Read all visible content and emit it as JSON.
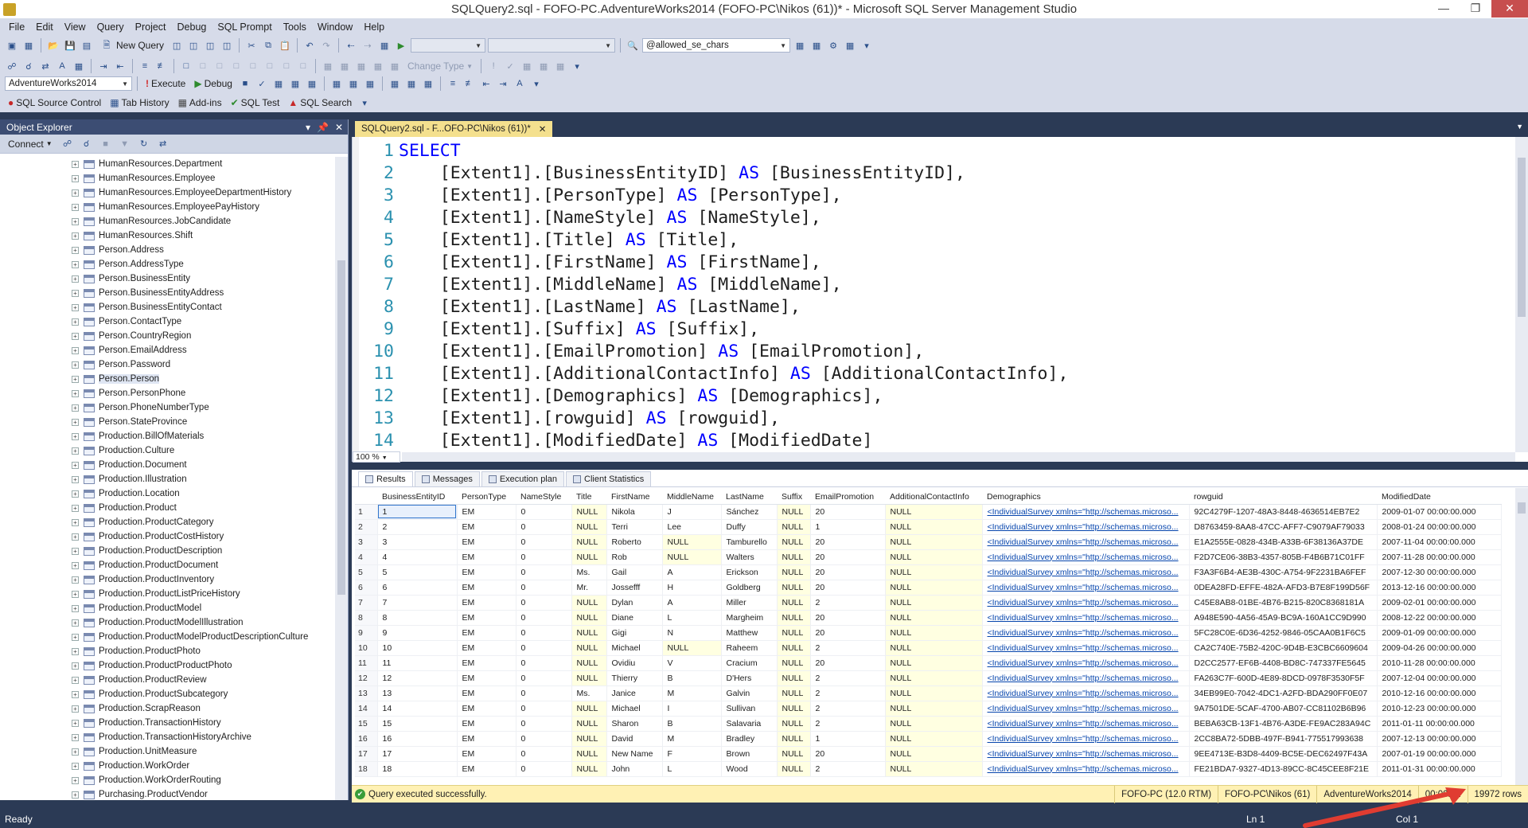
{
  "window": {
    "title": "SQLQuery2.sql - FOFO-PC.AdventureWorks2014 (FOFO-PC\\Nikos (61))* - Microsoft SQL Server Management Studio"
  },
  "menu": [
    "File",
    "Edit",
    "View",
    "Query",
    "Project",
    "Debug",
    "SQL Prompt",
    "Tools",
    "Window",
    "Help"
  ],
  "toolbar1": {
    "new_query": "New Query",
    "search_combo_value": "@allowed_se_chars"
  },
  "toolbar2": {
    "database": "AdventureWorks2014",
    "execute": "Execute",
    "debug": "Debug",
    "change_type": "Change Type"
  },
  "toolbar3": {
    "source_control": "SQL Source Control",
    "tab_history": "Tab History",
    "addins": "Add-ins",
    "sql_test": "SQL Test",
    "sql_search": "SQL Search"
  },
  "object_explorer": {
    "title": "Object Explorer",
    "connect": "Connect",
    "items": [
      "HumanResources.Department",
      "HumanResources.Employee",
      "HumanResources.EmployeeDepartmentHistory",
      "HumanResources.EmployeePayHistory",
      "HumanResources.JobCandidate",
      "HumanResources.Shift",
      "Person.Address",
      "Person.AddressType",
      "Person.BusinessEntity",
      "Person.BusinessEntityAddress",
      "Person.BusinessEntityContact",
      "Person.ContactType",
      "Person.CountryRegion",
      "Person.EmailAddress",
      "Person.Password",
      "Person.Person",
      "Person.PersonPhone",
      "Person.PhoneNumberType",
      "Person.StateProvince",
      "Production.BillOfMaterials",
      "Production.Culture",
      "Production.Document",
      "Production.Illustration",
      "Production.Location",
      "Production.Product",
      "Production.ProductCategory",
      "Production.ProductCostHistory",
      "Production.ProductDescription",
      "Production.ProductDocument",
      "Production.ProductInventory",
      "Production.ProductListPriceHistory",
      "Production.ProductModel",
      "Production.ProductModelIllustration",
      "Production.ProductModelProductDescriptionCulture",
      "Production.ProductPhoto",
      "Production.ProductProductPhoto",
      "Production.ProductReview",
      "Production.ProductSubcategory",
      "Production.ScrapReason",
      "Production.TransactionHistory",
      "Production.TransactionHistoryArchive",
      "Production.UnitMeasure",
      "Production.WorkOrder",
      "Production.WorkOrderRouting",
      "Purchasing.ProductVendor"
    ]
  },
  "editor": {
    "tab_label": "SQLQuery2.sql - F...OFO-PC\\Nikos (61))*",
    "zoom": "100 %",
    "lines": [
      {
        "n": "1",
        "pre": "",
        "kw": "SELECT",
        "post": ""
      },
      {
        "n": "2",
        "pre": "    [Extent1].[BusinessEntityID] ",
        "kw": "AS",
        "post": " [BusinessEntityID],"
      },
      {
        "n": "3",
        "pre": "    [Extent1].[PersonType] ",
        "kw": "AS",
        "post": " [PersonType],"
      },
      {
        "n": "4",
        "pre": "    [Extent1].[NameStyle] ",
        "kw": "AS",
        "post": " [NameStyle],"
      },
      {
        "n": "5",
        "pre": "    [Extent1].[Title] ",
        "kw": "AS",
        "post": " [Title],"
      },
      {
        "n": "6",
        "pre": "    [Extent1].[FirstName] ",
        "kw": "AS",
        "post": " [FirstName],"
      },
      {
        "n": "7",
        "pre": "    [Extent1].[MiddleName] ",
        "kw": "AS",
        "post": " [MiddleName],"
      },
      {
        "n": "8",
        "pre": "    [Extent1].[LastName] ",
        "kw": "AS",
        "post": " [LastName],"
      },
      {
        "n": "9",
        "pre": "    [Extent1].[Suffix] ",
        "kw": "AS",
        "post": " [Suffix],"
      },
      {
        "n": "10",
        "pre": "    [Extent1].[EmailPromotion] ",
        "kw": "AS",
        "post": " [EmailPromotion],"
      },
      {
        "n": "11",
        "pre": "    [Extent1].[AdditionalContactInfo] ",
        "kw": "AS",
        "post": " [AdditionalContactInfo],"
      },
      {
        "n": "12",
        "pre": "    [Extent1].[Demographics] ",
        "kw": "AS",
        "post": " [Demographics],"
      },
      {
        "n": "13",
        "pre": "    [Extent1].[rowguid] ",
        "kw": "AS",
        "post": " [rowguid],"
      },
      {
        "n": "14",
        "pre": "    [Extent1].[ModifiedDate] ",
        "kw": "AS",
        "post": " [ModifiedDate]"
      }
    ]
  },
  "results": {
    "tabs": [
      "Results",
      "Messages",
      "Execution plan",
      "Client Statistics"
    ],
    "columns": [
      "",
      "BusinessEntityID",
      "PersonType",
      "NameStyle",
      "Title",
      "FirstName",
      "MiddleName",
      "LastName",
      "Suffix",
      "EmailPromotion",
      "AdditionalContactInfo",
      "Demographics",
      "rowguid",
      "ModifiedDate"
    ],
    "rows": [
      [
        "1",
        "1",
        "EM",
        "0",
        "NULL",
        "Nikola",
        "J",
        "Sánchez",
        "NULL",
        "20",
        "NULL",
        "<IndividualSurvey xmlns=\"http://schemas.microso...",
        "92C4279F-1207-48A3-8448-4636514EB7E2",
        "2009-01-07 00:00:00.000"
      ],
      [
        "2",
        "2",
        "EM",
        "0",
        "NULL",
        "Terri",
        "Lee",
        "Duffy",
        "NULL",
        "1",
        "NULL",
        "<IndividualSurvey xmlns=\"http://schemas.microso...",
        "D8763459-8AA8-47CC-AFF7-C9079AF79033",
        "2008-01-24 00:00:00.000"
      ],
      [
        "3",
        "3",
        "EM",
        "0",
        "NULL",
        "Roberto",
        "NULL",
        "Tamburello",
        "NULL",
        "20",
        "NULL",
        "<IndividualSurvey xmlns=\"http://schemas.microso...",
        "E1A2555E-0828-434B-A33B-6F38136A37DE",
        "2007-11-04 00:00:00.000"
      ],
      [
        "4",
        "4",
        "EM",
        "0",
        "NULL",
        "Rob",
        "NULL",
        "Walters",
        "NULL",
        "20",
        "NULL",
        "<IndividualSurvey xmlns=\"http://schemas.microso...",
        "F2D7CE06-38B3-4357-805B-F4B6B71C01FF",
        "2007-11-28 00:00:00.000"
      ],
      [
        "5",
        "5",
        "EM",
        "0",
        "Ms.",
        "Gail",
        "A",
        "Erickson",
        "NULL",
        "20",
        "NULL",
        "<IndividualSurvey xmlns=\"http://schemas.microso...",
        "F3A3F6B4-AE3B-430C-A754-9F2231BA6FEF",
        "2007-12-30 00:00:00.000"
      ],
      [
        "6",
        "6",
        "EM",
        "0",
        "Mr.",
        "Jossefff",
        "H",
        "Goldberg",
        "NULL",
        "20",
        "NULL",
        "<IndividualSurvey xmlns=\"http://schemas.microso...",
        "0DEA28FD-EFFE-482A-AFD3-B7E8F199D56F",
        "2013-12-16 00:00:00.000"
      ],
      [
        "7",
        "7",
        "EM",
        "0",
        "NULL",
        "Dylan",
        "A",
        "Miller",
        "NULL",
        "2",
        "NULL",
        "<IndividualSurvey xmlns=\"http://schemas.microso...",
        "C45E8AB8-01BE-4B76-B215-820C8368181A",
        "2009-02-01 00:00:00.000"
      ],
      [
        "8",
        "8",
        "EM",
        "0",
        "NULL",
        "Diane",
        "L",
        "Margheim",
        "NULL",
        "20",
        "NULL",
        "<IndividualSurvey xmlns=\"http://schemas.microso...",
        "A948E590-4A56-45A9-BC9A-160A1CC9D990",
        "2008-12-22 00:00:00.000"
      ],
      [
        "9",
        "9",
        "EM",
        "0",
        "NULL",
        "Gigi",
        "N",
        "Matthew",
        "NULL",
        "20",
        "NULL",
        "<IndividualSurvey xmlns=\"http://schemas.microso...",
        "5FC28C0E-6D36-4252-9846-05CAA0B1F6C5",
        "2009-01-09 00:00:00.000"
      ],
      [
        "10",
        "10",
        "EM",
        "0",
        "NULL",
        "Michael",
        "NULL",
        "Raheem",
        "NULL",
        "2",
        "NULL",
        "<IndividualSurvey xmlns=\"http://schemas.microso...",
        "CA2C740E-75B2-420C-9D4B-E3CBC6609604",
        "2009-04-26 00:00:00.000"
      ],
      [
        "11",
        "11",
        "EM",
        "0",
        "NULL",
        "Ovidiu",
        "V",
        "Cracium",
        "NULL",
        "20",
        "NULL",
        "<IndividualSurvey xmlns=\"http://schemas.microso...",
        "D2CC2577-EF6B-4408-BD8C-747337FE5645",
        "2010-11-28 00:00:00.000"
      ],
      [
        "12",
        "12",
        "EM",
        "0",
        "NULL",
        "Thierry",
        "B",
        "D'Hers",
        "NULL",
        "2",
        "NULL",
        "<IndividualSurvey xmlns=\"http://schemas.microso...",
        "FA263C7F-600D-4E89-8DCD-0978F3530F5F",
        "2007-12-04 00:00:00.000"
      ],
      [
        "13",
        "13",
        "EM",
        "0",
        "Ms.",
        "Janice",
        "M",
        "Galvin",
        "NULL",
        "2",
        "NULL",
        "<IndividualSurvey xmlns=\"http://schemas.microso...",
        "34EB99E0-7042-4DC1-A2FD-BDA290FF0E07",
        "2010-12-16 00:00:00.000"
      ],
      [
        "14",
        "14",
        "EM",
        "0",
        "NULL",
        "Michael",
        "I",
        "Sullivan",
        "NULL",
        "2",
        "NULL",
        "<IndividualSurvey xmlns=\"http://schemas.microso...",
        "9A7501DE-5CAF-4700-AB07-CC81102B6B96",
        "2010-12-23 00:00:00.000"
      ],
      [
        "15",
        "15",
        "EM",
        "0",
        "NULL",
        "Sharon",
        "B",
        "Salavaria",
        "NULL",
        "2",
        "NULL",
        "<IndividualSurvey xmlns=\"http://schemas.microso...",
        "BEBA63CB-13F1-4B76-A3DE-FE9AC283A94C",
        "2011-01-11 00:00:00.000"
      ],
      [
        "16",
        "16",
        "EM",
        "0",
        "NULL",
        "David",
        "M",
        "Bradley",
        "NULL",
        "1",
        "NULL",
        "<IndividualSurvey xmlns=\"http://schemas.microso...",
        "2CC8BA72-5DBB-497F-B941-775517993638",
        "2007-12-13 00:00:00.000"
      ],
      [
        "17",
        "17",
        "EM",
        "0",
        "NULL",
        "New Name",
        "F",
        "Brown",
        "NULL",
        "20",
        "NULL",
        "<IndividualSurvey xmlns=\"http://schemas.microso...",
        "9EE4713E-B3D8-4409-BC5E-DEC62497F43A",
        "2007-01-19 00:00:00.000"
      ],
      [
        "18",
        "18",
        "EM",
        "0",
        "NULL",
        "John",
        "L",
        "Wood",
        "NULL",
        "2",
        "NULL",
        "<IndividualSurvey xmlns=\"http://schemas.microso...",
        "FE21BDA7-9327-4D13-89CC-8C45CEE8F21E",
        "2011-01-31 00:00:00.000"
      ]
    ]
  },
  "query_status": {
    "message": "Query executed successfully.",
    "server": "FOFO-PC (12.0 RTM)",
    "user": "FOFO-PC\\Nikos (61)",
    "database": "AdventureWorks2014",
    "elapsed": "00:00:01",
    "rows": "19972 rows"
  },
  "statusbar": {
    "ready": "Ready",
    "ln": "Ln 1",
    "col": "Col 1"
  },
  "colors": {
    "accent_dark": "#2b3a55",
    "toolbar": "#d6dbe9",
    "tab_active": "#f4e08e",
    "status_ok": "#fff1b4",
    "keyword": "#0000ff",
    "line_number": "#2b91af",
    "null_cell": "#ffffe1",
    "annotation_arrow": "#e03c31"
  }
}
